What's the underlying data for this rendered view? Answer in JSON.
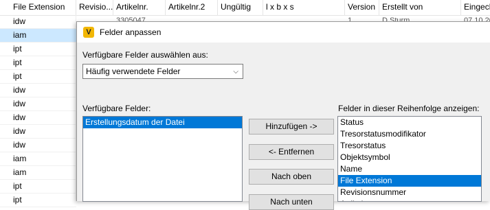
{
  "grid": {
    "headers": [
      "File Extension",
      "Revisio...",
      "Artikelnr.",
      "Artikelnr.2",
      "Ungültig",
      "l x b x s",
      "Version",
      "Erstellt von",
      "Eingech"
    ],
    "first_row": {
      "artikelnr": "3305047",
      "version": "1",
      "erstellt_von": "D.Sturm",
      "eingecheckt": "07.10.20"
    },
    "extensions": [
      "idw",
      "iam",
      "ipt",
      "ipt",
      "ipt",
      "idw",
      "idw",
      "idw",
      "idw",
      "idw",
      "iam",
      "iam",
      "ipt",
      "ipt"
    ],
    "selected_row_index": 1
  },
  "dialog": {
    "title": "Felder anpassen",
    "icon_letter": "V",
    "source_label": "Verfügbare Felder auswählen aus:",
    "source_value": "Häufig verwendete Felder",
    "available_label": "Verfügbare Felder:",
    "available_items": [
      "Erstellungsdatum der Datei"
    ],
    "selected_label": "Felder in dieser Reihenfolge anzeigen:",
    "selected_items": [
      "Status",
      "Tresorstatusmodifikator",
      "Tresorstatus",
      "Objektsymbol",
      "Name",
      "File Extension",
      "Revisionsnummer",
      "Artikelnr."
    ],
    "selected_highlight_index": 5,
    "buttons": {
      "add": "Hinzufügen ->",
      "remove": "<- Entfernen",
      "up": "Nach oben",
      "down": "Nach unten"
    }
  }
}
